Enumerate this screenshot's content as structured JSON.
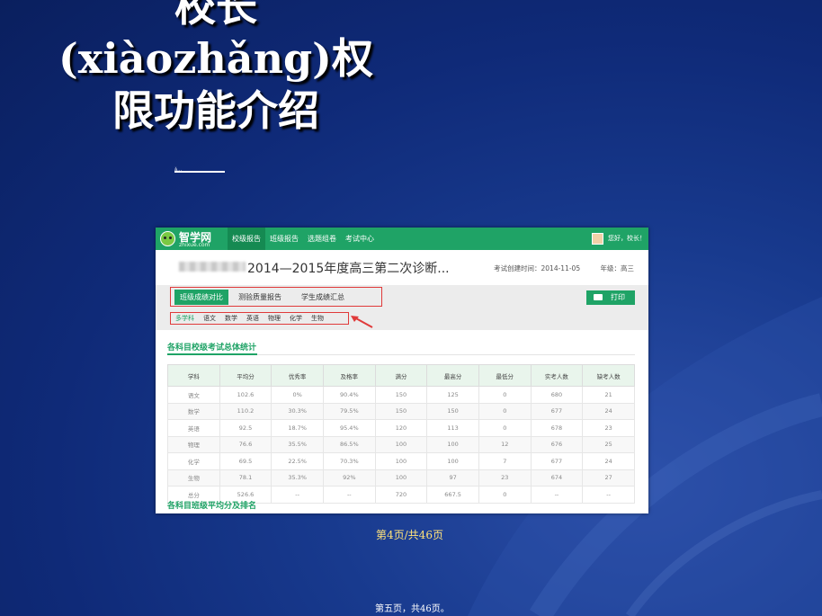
{
  "slide": {
    "title_lines": [
      "校长",
      "(xiàozhǎng)权",
      "限功能介绍"
    ],
    "tiny_label": "ǎ…",
    "page_indicator": "第4页/共46页",
    "footer": "第五页，共46页。"
  },
  "app": {
    "logo_name": "智学网",
    "logo_url": "zhixue.com",
    "nav": [
      "校级报告",
      "班级报告",
      "选题组卷",
      "考试中心"
    ],
    "greeting": "您好，校长！"
  },
  "exam": {
    "title": "2014—2015年度高三第二次诊断...",
    "created": "考试创建时间：2014-11-05",
    "grade": "年级：高三"
  },
  "tabs": [
    "班级成绩对比",
    "测验质量报告",
    "学生成绩汇总"
  ],
  "print_label": "打印",
  "subjects": [
    "多学科",
    "语文",
    "数学",
    "英语",
    "物理",
    "化学",
    "生物"
  ],
  "section1_title": "各科目校级考试总体统计",
  "table": {
    "headers": [
      "学科",
      "平均分",
      "优秀率",
      "及格率",
      "满分",
      "最高分",
      "最低分",
      "实考人数",
      "缺考人数"
    ],
    "rows": [
      [
        "语文",
        "102.6",
        "0%",
        "90.4%",
        "150",
        "125",
        "0",
        "680",
        "21"
      ],
      [
        "数学",
        "110.2",
        "30.3%",
        "79.5%",
        "150",
        "150",
        "0",
        "677",
        "24"
      ],
      [
        "英语",
        "92.5",
        "18.7%",
        "95.4%",
        "120",
        "113",
        "0",
        "678",
        "23"
      ],
      [
        "物理",
        "76.6",
        "35.5%",
        "86.5%",
        "100",
        "100",
        "12",
        "676",
        "25"
      ],
      [
        "化学",
        "69.5",
        "22.5%",
        "70.3%",
        "100",
        "100",
        "7",
        "677",
        "24"
      ],
      [
        "生物",
        "78.1",
        "35.3%",
        "92%",
        "100",
        "97",
        "23",
        "674",
        "27"
      ],
      [
        "总分",
        "526.6",
        "--",
        "--",
        "720",
        "667.5",
        "0",
        "--",
        "--"
      ]
    ]
  },
  "section2_title": "各科目班级平均分及排名",
  "colors": {
    "brand_green": "#1fa366",
    "highlight_red": "#e03a3a",
    "slide_bg": "#0f2a78",
    "page_indicator": "#ffe27a"
  }
}
